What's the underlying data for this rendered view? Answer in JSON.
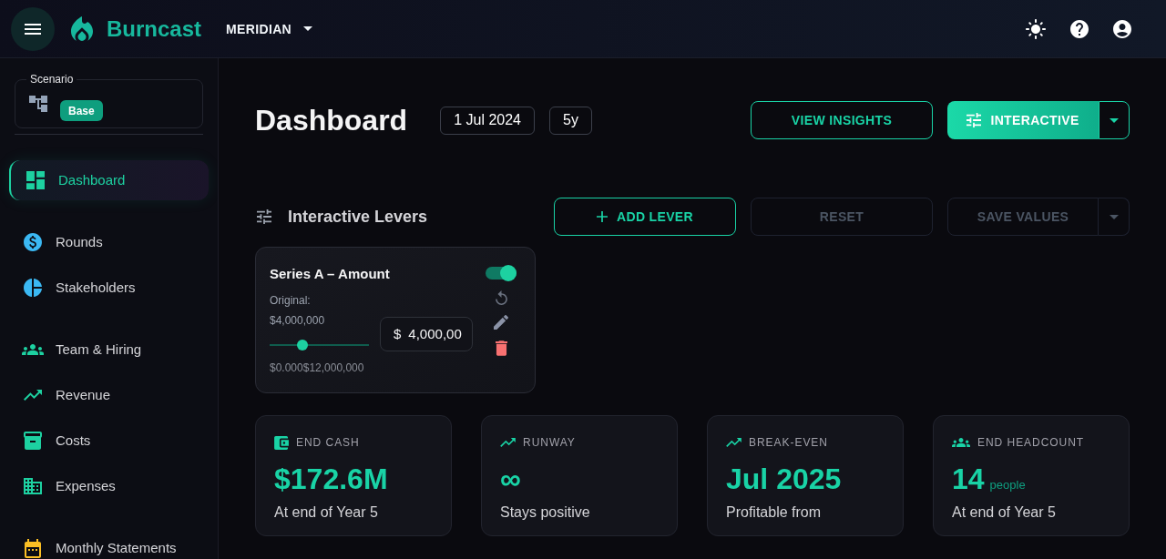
{
  "header": {
    "brand": "Burncast",
    "company": "MERIDIAN"
  },
  "sidebar": {
    "scenario": {
      "label": "Scenario",
      "value": "Base"
    },
    "groups": [
      {
        "items": [
          {
            "label": "Dashboard",
            "selected": true,
            "color": "#1dd1a1"
          }
        ]
      },
      {
        "items": [
          {
            "label": "Rounds",
            "selected": false,
            "color": "#3bb8f3"
          },
          {
            "label": "Stakeholders",
            "selected": false,
            "color": "#3bb8f3"
          }
        ]
      },
      {
        "items": [
          {
            "label": "Team & Hiring",
            "selected": false,
            "color": "#1dd1a1"
          },
          {
            "label": "Revenue",
            "selected": false,
            "color": "#1dd1a1"
          },
          {
            "label": "Costs",
            "selected": false,
            "color": "#1dd1a1"
          },
          {
            "label": "Expenses",
            "selected": false,
            "color": "#1dd1a1"
          }
        ]
      },
      {
        "items": [
          {
            "label": "Monthly Statements",
            "selected": false,
            "color": "#fbbf24"
          }
        ]
      }
    ]
  },
  "page": {
    "title": "Dashboard",
    "date": "1 Jul 2024",
    "horizon": "5y",
    "insights_button": "VIEW INSIGHTS",
    "mode_button": "INTERACTIVE"
  },
  "levers": {
    "title": "Interactive Levers",
    "buttons": [
      {
        "label": "ADD LEVER",
        "kind": "add",
        "disabled": false
      },
      {
        "label": "RESET",
        "kind": "plain",
        "disabled": true
      },
      {
        "label": "SAVE VALUES",
        "kind": "split",
        "disabled": true
      }
    ],
    "cards": [
      {
        "title": "Series A – Amount",
        "on": true,
        "original_label": "Original:",
        "original_value": "$4,000,000",
        "level": 0.333,
        "min": "$0.000",
        "max": "$12,000,000",
        "currency": "$",
        "value": "4,000,00"
      }
    ]
  },
  "stats": [
    {
      "label": "END CASH",
      "value": "$172.6M",
      "caption": "At end of Year 5"
    },
    {
      "label": "RUNWAY",
      "value": "∞",
      "caption": "Stays positive"
    },
    {
      "label": "BREAK-EVEN",
      "value": "Jul 2025",
      "caption": "Profitable from"
    },
    {
      "label": "END HEADCOUNT",
      "value": "14",
      "unit": "people",
      "caption": "At end of Year 5"
    }
  ]
}
